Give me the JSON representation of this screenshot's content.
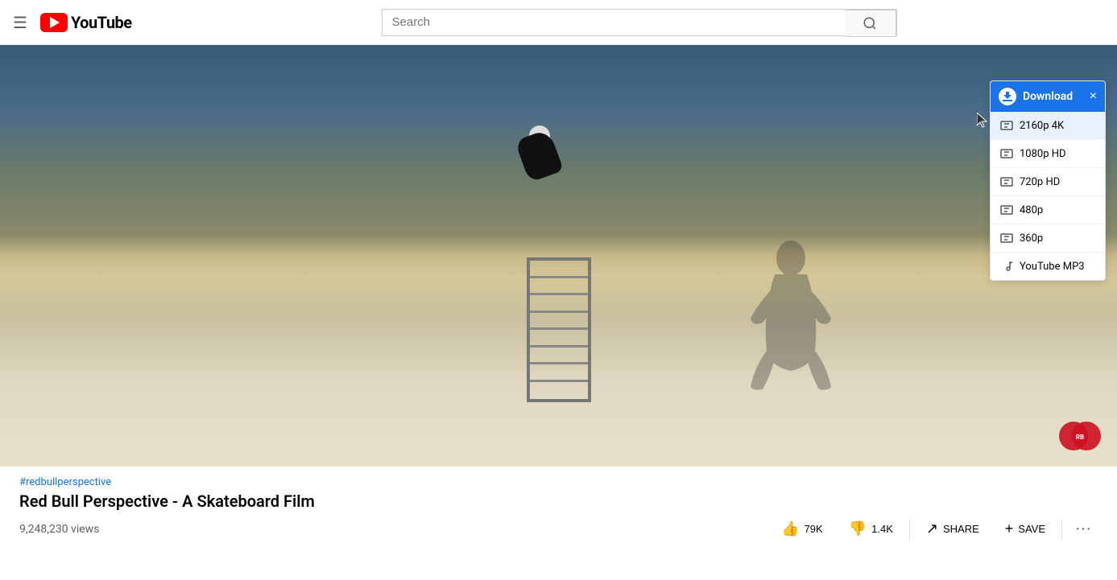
{
  "header": {
    "menu_icon": "☰",
    "youtube_text": "YouTube",
    "search_placeholder": "Search"
  },
  "video": {
    "hashtag": "#redbullperspective",
    "title": "Red Bull Perspective - A Skateboard Film",
    "views": "9,248,230 views",
    "likes": "79K",
    "dislikes": "1.4K",
    "share_label": "SHARE",
    "save_label": "SAVE"
  },
  "download_dropdown": {
    "title": "Download",
    "close_label": "×",
    "qualities": [
      {
        "label": "2160p 4K",
        "icon": "video",
        "highlighted": true
      },
      {
        "label": "1080p HD",
        "icon": "video",
        "highlighted": false
      },
      {
        "label": "720p HD",
        "icon": "video",
        "highlighted": false
      },
      {
        "label": "480p",
        "icon": "video",
        "highlighted": false
      },
      {
        "label": "360p",
        "icon": "video",
        "highlighted": false
      },
      {
        "label": "YouTube MP3",
        "icon": "music",
        "highlighted": false
      }
    ]
  }
}
